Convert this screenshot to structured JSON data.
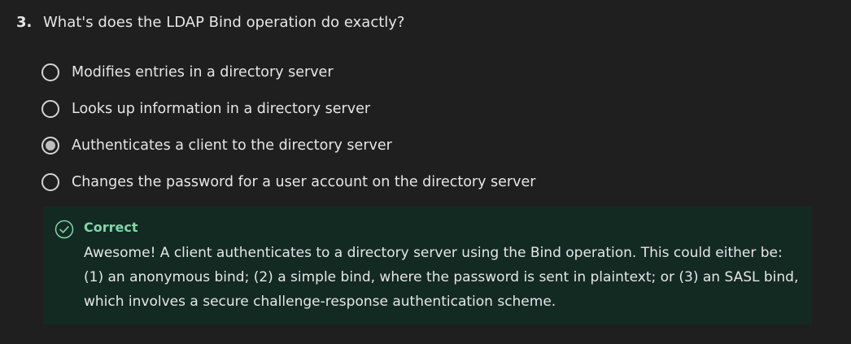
{
  "question": {
    "number": "3.",
    "text": "What's does the LDAP Bind operation do exactly?"
  },
  "options": [
    {
      "label": "Modifies entries in a directory server",
      "selected": false
    },
    {
      "label": "Looks up information in a directory server",
      "selected": false
    },
    {
      "label": "Authenticates a client to the directory server",
      "selected": true
    },
    {
      "label": "Changes the password for a user account on the directory server",
      "selected": false
    }
  ],
  "feedback": {
    "status": "Correct",
    "message": "Awesome! A client authenticates to a directory server using the Bind operation. This could either be: (1) an anonymous bind; (2) a simple bind, where the password is sent in plaintext; or (3) an SASL bind, which involves a secure challenge-response authentication scheme.",
    "icon": "check-circle-icon"
  },
  "colors": {
    "background": "#1f1f1f",
    "feedback_background": "#132a23",
    "success": "#7fd8a8"
  }
}
